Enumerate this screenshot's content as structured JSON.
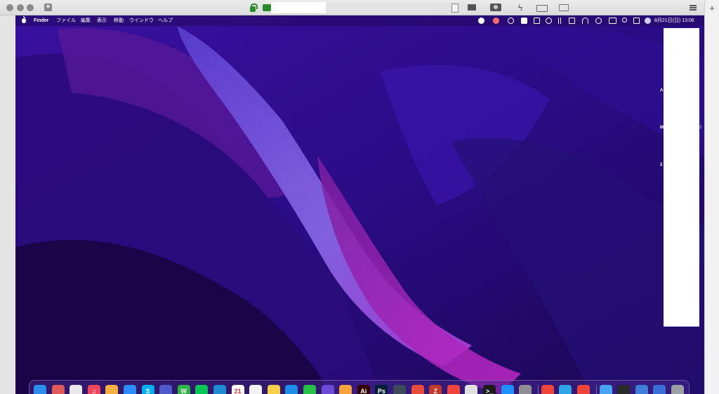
{
  "menubar": {
    "app_name": "Finder",
    "items": [
      "ファイル",
      "編集",
      "表示",
      "移動",
      "ウインドウ",
      "ヘルプ"
    ],
    "clock": "8月21日(日) 13:06"
  },
  "widgets": {
    "labels": [
      "A",
      "M",
      "2"
    ],
    "right_marks": [
      "",
      "2",
      ""
    ]
  },
  "host_toolbar": {
    "add_tab_label": "+",
    "bolt_glyph": "ϟ"
  },
  "dock": {
    "apps": [
      {
        "name": "finder",
        "label": "",
        "color": "#2e8ef0"
      },
      {
        "name": "launchpad",
        "label": "",
        "color": "#e05a5a"
      },
      {
        "name": "chrome",
        "label": "",
        "color": "#e8e8e8"
      },
      {
        "name": "music",
        "label": "♫",
        "color": "#f0455a"
      },
      {
        "name": "photos",
        "label": "",
        "color": "#f5b041"
      },
      {
        "name": "zoom",
        "label": "",
        "color": "#2d8cff"
      },
      {
        "name": "skype",
        "label": "S",
        "color": "#00aff0"
      },
      {
        "name": "teams",
        "label": "",
        "color": "#5059c9"
      },
      {
        "name": "wps",
        "label": "W",
        "color": "#2fb344"
      },
      {
        "name": "line",
        "label": "",
        "color": "#06c755"
      },
      {
        "name": "vscode",
        "label": "",
        "color": "#1f8ad2"
      },
      {
        "name": "calendar",
        "label": "21",
        "color": "#ffffff"
      },
      {
        "name": "reminders",
        "label": "",
        "color": "#f2f2f2"
      },
      {
        "name": "notes",
        "label": "",
        "color": "#f7d049"
      },
      {
        "name": "keynote",
        "label": "",
        "color": "#1d8fe8"
      },
      {
        "name": "numbers",
        "label": "",
        "color": "#28c24a"
      },
      {
        "name": "imovie",
        "label": "",
        "color": "#6a4cd6"
      },
      {
        "name": "pages",
        "label": "",
        "color": "#f7a23a"
      },
      {
        "name": "illustrator",
        "label": "Ai",
        "color": "#330000"
      },
      {
        "name": "photoshop",
        "label": "Ps",
        "color": "#001e36"
      },
      {
        "name": "davinci",
        "label": "",
        "color": "#3c4a5c"
      },
      {
        "name": "xmind",
        "label": "",
        "color": "#e64b3b"
      },
      {
        "name": "filezilla",
        "label": "Z",
        "color": "#c0392b"
      },
      {
        "name": "anydesk",
        "label": "",
        "color": "#ef443b"
      },
      {
        "name": "sequel",
        "label": "",
        "color": "#e0e0e0"
      },
      {
        "name": "terminal",
        "label": ">_",
        "color": "#1b1b1b"
      },
      {
        "name": "app-store",
        "label": "",
        "color": "#1e90ff"
      },
      {
        "name": "system-preferences",
        "label": "",
        "color": "#8e8e93"
      },
      {
        "name": "anydesk-2",
        "label": "",
        "color": "#ef443b"
      },
      {
        "name": "safari-like",
        "label": "",
        "color": "#2fa4e7"
      },
      {
        "name": "anydesk-3",
        "label": "",
        "color": "#ef443b"
      },
      {
        "name": "downloads",
        "label": "",
        "color": "#4aa3f0"
      },
      {
        "name": "file-dark",
        "label": "",
        "color": "#2a2a2a"
      },
      {
        "name": "spreadsheet",
        "label": "",
        "color": "#3f7fd9"
      },
      {
        "name": "window",
        "label": "",
        "color": "#3a6fd8"
      },
      {
        "name": "trash",
        "label": "",
        "color": "#9aa0a6"
      }
    ]
  }
}
